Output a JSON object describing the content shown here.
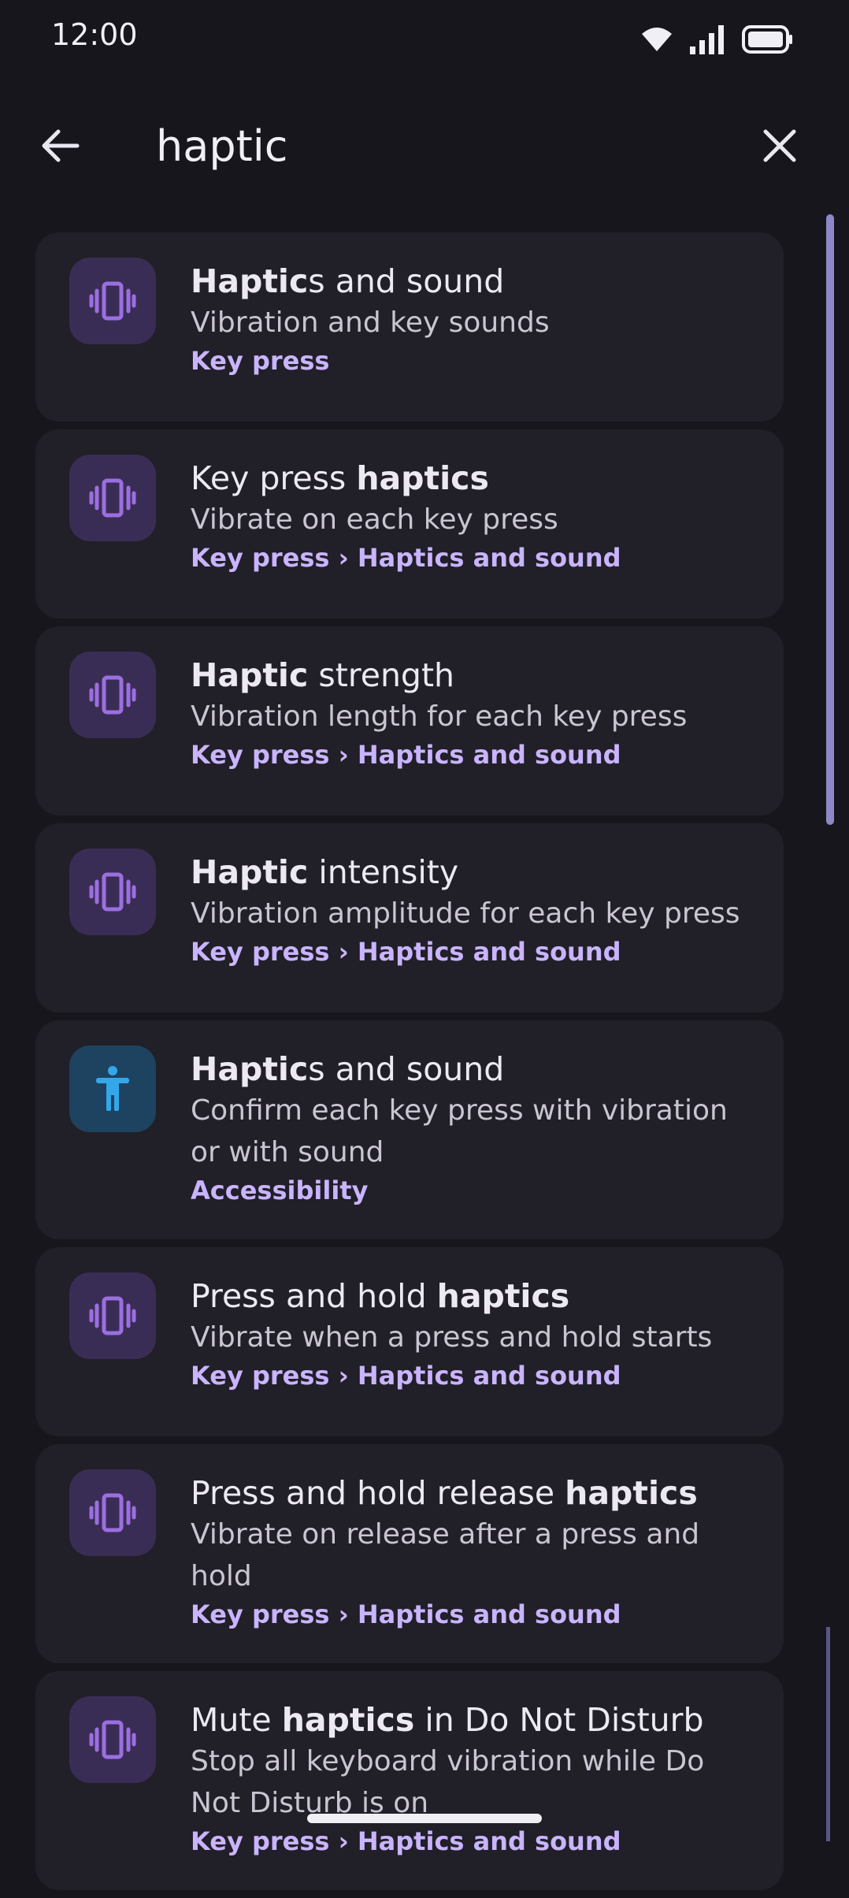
{
  "status": {
    "time": "12:00"
  },
  "search": {
    "query": "haptic"
  },
  "colors": {
    "background": "#17161d",
    "card": "#211f27",
    "accent": "#c9b4ff",
    "icon_vibrate": "#9b6fe0",
    "icon_accessibility": "#34a7ea"
  },
  "results": [
    {
      "icon": "vibrate-icon",
      "title_bold": "Haptic",
      "title_rest": "s and sound",
      "subtitle": "Vibration and key sounds",
      "crumb": "Key press"
    },
    {
      "icon": "vibrate-icon",
      "title_pre": "Key press ",
      "title_bold": "haptics",
      "title_rest": "",
      "subtitle": "Vibrate on each key press",
      "crumb": "Key press › Haptics and sound"
    },
    {
      "icon": "vibrate-icon",
      "title_bold": "Haptic",
      "title_rest": " strength",
      "subtitle": "Vibration length for each key press",
      "crumb": "Key press › Haptics and sound"
    },
    {
      "icon": "vibrate-icon",
      "title_bold": "Haptic",
      "title_rest": " intensity",
      "subtitle": "Vibration amplitude for each key press",
      "crumb": "Key press › Haptics and sound"
    },
    {
      "icon": "accessibility-icon",
      "title_bold": "Haptic",
      "title_rest": "s and sound",
      "subtitle": "Confirm each key press with vibration or with sound",
      "crumb": "Accessibility"
    },
    {
      "icon": "vibrate-icon",
      "title_pre": "Press and hold ",
      "title_bold": "haptics",
      "title_rest": "",
      "subtitle": "Vibrate when a press and hold starts",
      "crumb": "Key press › Haptics and sound"
    },
    {
      "icon": "vibrate-icon",
      "title_pre": "Press and hold release ",
      "title_bold": "haptics",
      "title_rest": "",
      "subtitle": "Vibrate on release after a press and hold",
      "crumb": "Key press › Haptics and sound"
    },
    {
      "icon": "vibrate-icon",
      "title_pre": "Mute ",
      "title_bold": "haptics",
      "title_rest": " in Do Not Disturb",
      "subtitle": "Stop all keyboard vibration while Do Not Disturb is on",
      "crumb": "Key press › Haptics and sound"
    }
  ]
}
